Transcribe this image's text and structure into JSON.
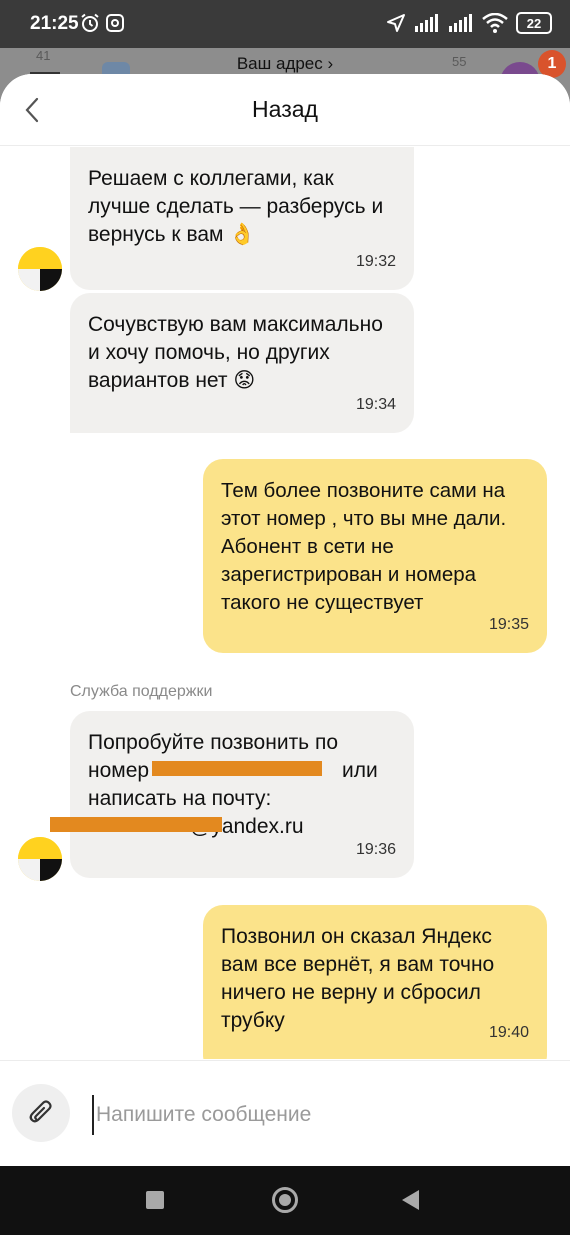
{
  "status_bar": {
    "time": "21:25",
    "battery": "22"
  },
  "map": {
    "address": "Ваш адрес ›",
    "badge_count": "1",
    "label_41": "41",
    "label_55": "55"
  },
  "header": {
    "title": "Назад"
  },
  "messages": [
    {
      "direction": "in",
      "text": "Решаем с коллегами, как лучше сделать — разберусь и вернусь к вам 👌",
      "time": "19:32"
    },
    {
      "direction": "in",
      "text": "Сочувствую вам максимально и хочу помочь, но других вариантов нет 😟",
      "time": "19:34"
    },
    {
      "direction": "out",
      "text": "Тем более позвоните сами на этот номер , что вы мне дали. Абонент в сети не зарегистрирован и номера такого не существует",
      "time": "19:35"
    },
    {
      "direction": "in",
      "sender": "Служба поддержки",
      "line1": "Попробуйте позвонить по",
      "line2_start": "номер",
      "line2_end": "или",
      "line3": "написать на почту:",
      "line4_end": "@yandex.ru",
      "time": "19:36"
    },
    {
      "direction": "out",
      "text": "Позвонил он сказал Яндекс вам все вернёт, я вам точно ничего не верну и сбросил трубку",
      "time": "19:40"
    }
  ],
  "input": {
    "placeholder": "Напишите сообщение"
  },
  "colors": {
    "incoming_bubble": "#f1f0ee",
    "outgoing_bubble": "#fbe38a",
    "brand_yellow": "#ffd21f",
    "redaction": "#e3891f"
  },
  "icons": [
    "alarm-icon",
    "instagram-icon",
    "location-arrow-icon",
    "signal-icon",
    "wifi-icon",
    "battery-icon",
    "back-chevron-icon",
    "yandex-support-avatar-icon",
    "paperclip-icon",
    "nav-recents-icon",
    "nav-home-icon",
    "nav-back-icon"
  ]
}
